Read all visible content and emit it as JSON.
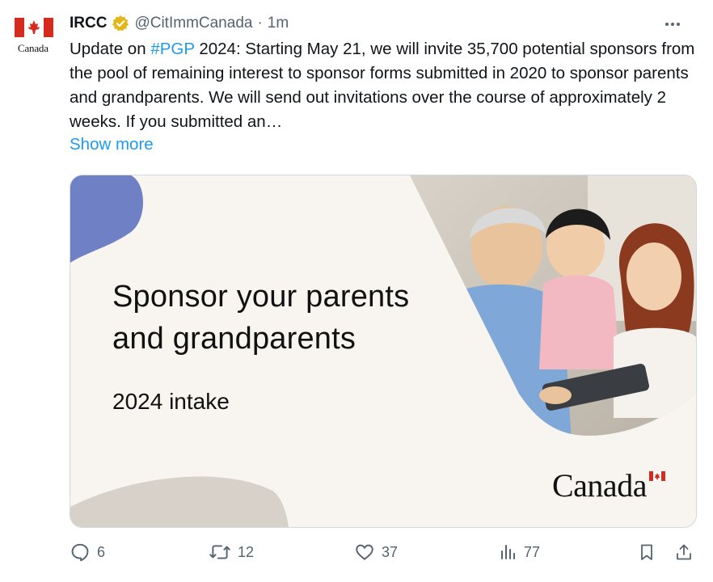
{
  "avatar": {
    "label": "Canada"
  },
  "header": {
    "name": "IRCC",
    "handle": "@CitImmCanada",
    "separator": "·",
    "time": "1m"
  },
  "tweet": {
    "text_before": "Update on ",
    "hashtag": "#PGP",
    "text_after": " 2024: Starting May 21, we will invite 35,700 potential sponsors from the pool of remaining interest to sponsor forms submitted in 2020 to sponsor parents and grandparents. We will send out invitations over the course of approximately 2 weeks. If you submitted an…",
    "show_more": "Show more"
  },
  "media": {
    "title_line1": "Sponsor your parents",
    "title_line2": "and grandparents",
    "subtitle": "2024 intake",
    "wordmark": "Canada"
  },
  "actions": {
    "replies": "6",
    "reposts": "12",
    "likes": "37",
    "views": "77"
  },
  "colors": {
    "accent": "#1d9bf0",
    "text": "#0f1419",
    "muted": "#536471",
    "canada_red": "#d52b1e",
    "blob_blue": "#7080c4",
    "verified_gold": "#e2b719"
  }
}
